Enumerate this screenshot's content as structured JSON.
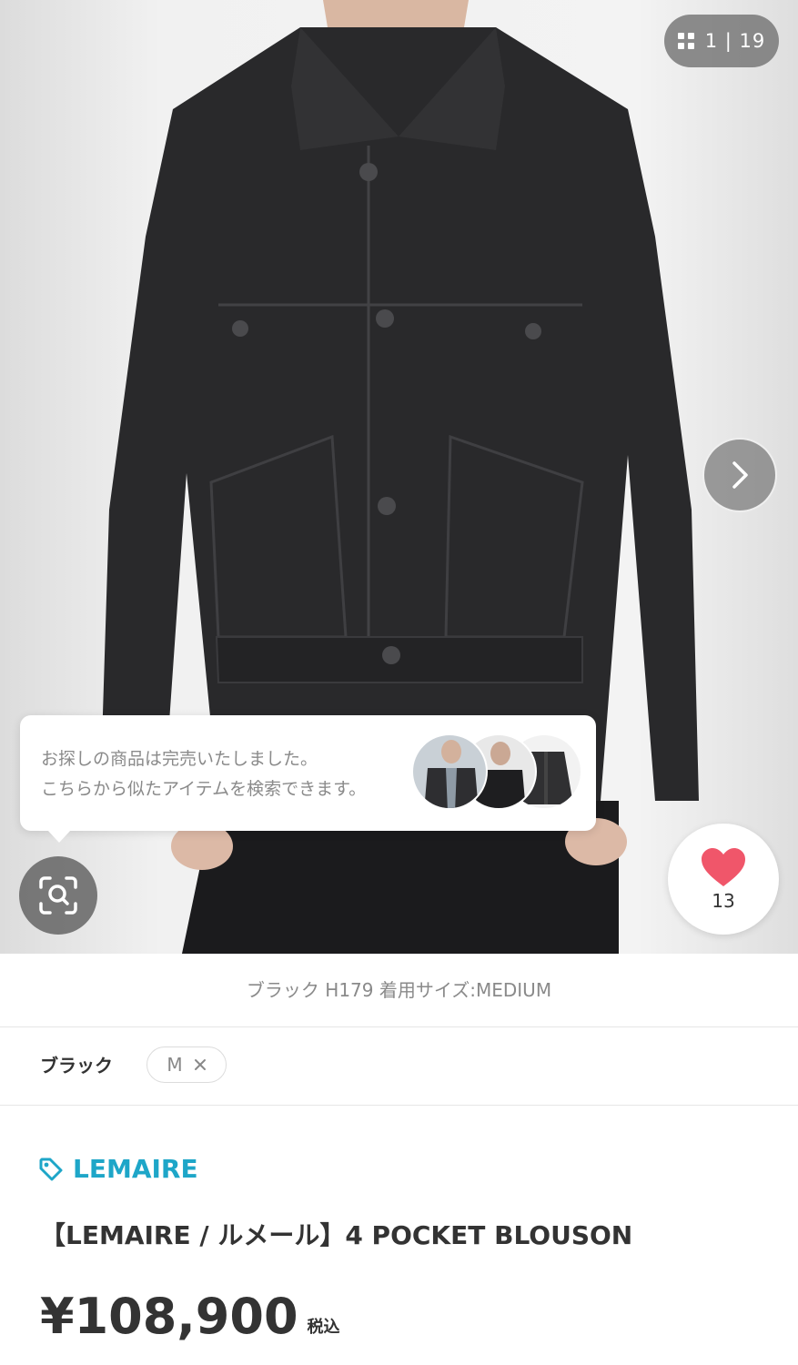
{
  "gallery": {
    "counter": "1 | 19",
    "next_icon": "chevron-right-icon",
    "grid_icon": "grid-icon"
  },
  "sold_out_popup": {
    "line1": "お探しの商品は完売いたしました。",
    "line2": "こちらから似たアイテムを検索できます。"
  },
  "image_search": {
    "icon": "image-search-icon"
  },
  "favorite": {
    "count": "13",
    "icon": "heart-icon",
    "color": "#f0566a"
  },
  "image_caption": "ブラック H179 着用サイズ:MEDIUM",
  "variant": {
    "color": "ブラック",
    "size": "M",
    "remove_icon": "close-icon"
  },
  "brand": {
    "name": "LEMAIRE",
    "icon": "tag-icon",
    "color": "#1ea6c8"
  },
  "product": {
    "title": "【LEMAIRE / ルメール】4 POCKET BLOUSON",
    "price": "¥108,900",
    "tax_label": "税込"
  }
}
